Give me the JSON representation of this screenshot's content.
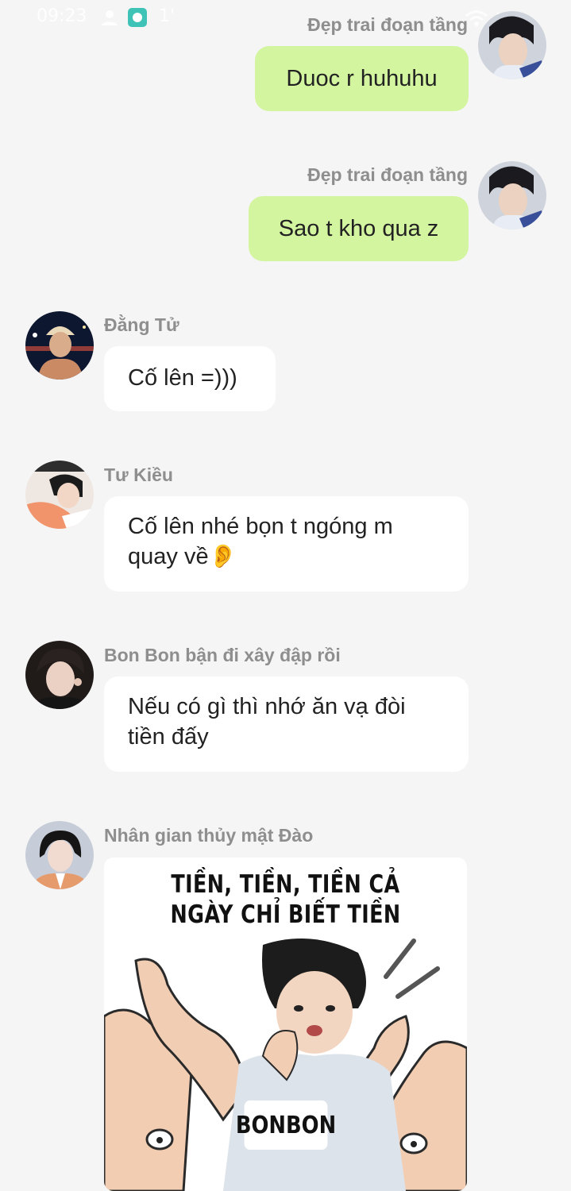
{
  "status_bar": {
    "time": "09:23",
    "icons": [
      "user-icon",
      "app-notification-icon",
      "signal-icon",
      "wifi-icon",
      "battery-icon"
    ]
  },
  "messages": [
    {
      "sender": "Đẹp trai đoạn tầng",
      "text": "Duoc r huhuhu",
      "direction": "outgoing"
    },
    {
      "sender": "Đẹp trai đoạn tầng",
      "text": "Sao t kho qua z",
      "direction": "outgoing"
    },
    {
      "sender": "Đằng Tử",
      "text": "Cố lên =)))",
      "direction": "incoming"
    },
    {
      "sender": "Tư Kiều",
      "text": "Cố lên nhé bọn t ngóng m quay về👂",
      "direction": "incoming"
    },
    {
      "sender": "Bon Bon bận đi xây đập rồi",
      "text": "Nếu có gì thì nhớ ăn vạ đòi tiền đấy",
      "direction": "incoming"
    },
    {
      "sender": "Nhân gian thủy mật Đào",
      "direction": "incoming",
      "type": "sticker",
      "sticker": {
        "line1": "TIỀN, TIỀN, TIỀN CẢ",
        "line2": "NGÀY CHỈ BIẾT TIỀN",
        "tag": "BONBON"
      }
    }
  ],
  "colors": {
    "background": "#f5f5f5",
    "outgoing_bubble": "#d4f5a0",
    "incoming_bubble": "#ffffff",
    "sender_name": "#8e8e8e"
  }
}
